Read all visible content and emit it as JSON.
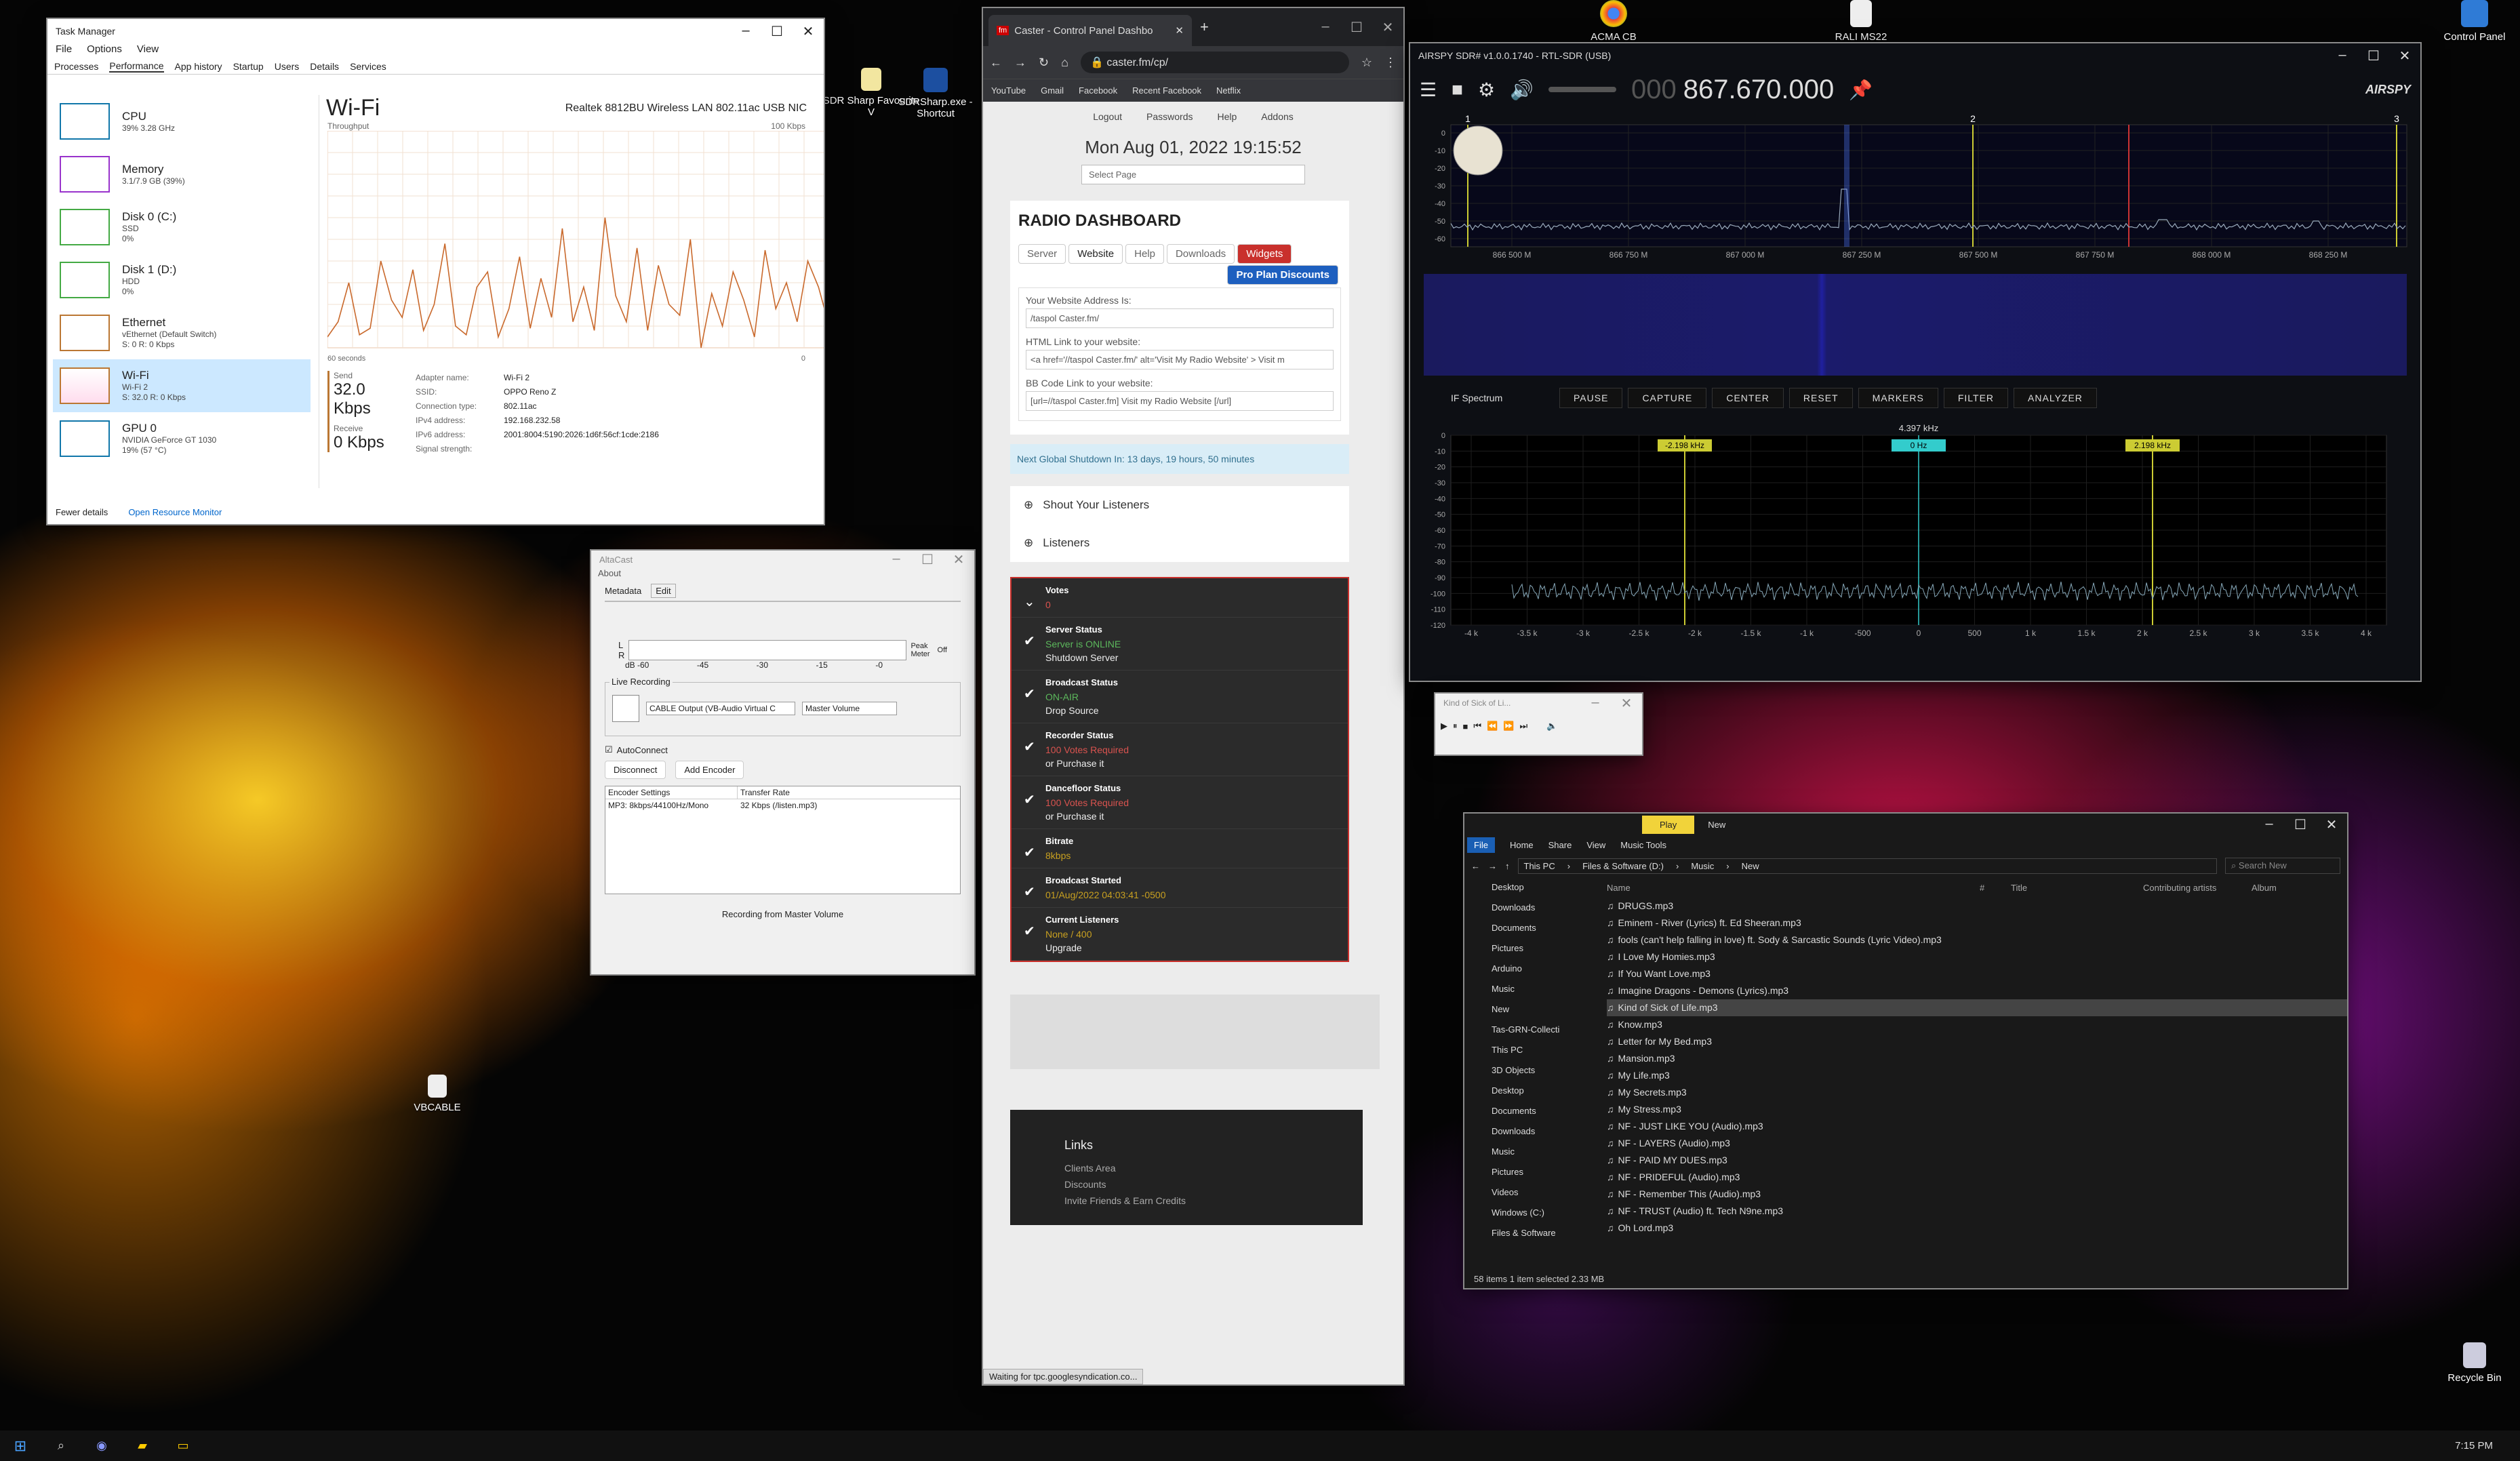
{
  "desktop": {
    "icons": [
      {
        "label": "ACMA CB"
      },
      {
        "label": "RALI MS22"
      },
      {
        "label": "Control Panel"
      },
      {
        "label": "SDR Sharp Favourite V"
      },
      {
        "label": "SDRSharp.exe - Shortcut"
      },
      {
        "label": "VBCABLE"
      },
      {
        "label": "Recycle Bin"
      }
    ]
  },
  "taskmgr": {
    "title": "Task Manager",
    "menu": [
      "File",
      "Options",
      "View"
    ],
    "tabs": [
      "Processes",
      "Performance",
      "App history",
      "Startup",
      "Users",
      "Details",
      "Services"
    ],
    "side": [
      {
        "name": "CPU",
        "l1": "39% 3.28 GHz",
        "l2": ""
      },
      {
        "name": "Memory",
        "l1": "3.1/7.9 GB (39%)",
        "l2": ""
      },
      {
        "name": "Disk 0 (C:)",
        "l1": "SSD",
        "l2": "0%"
      },
      {
        "name": "Disk 1 (D:)",
        "l1": "HDD",
        "l2": "0%"
      },
      {
        "name": "Ethernet",
        "l1": "vEthernet (Default Switch)",
        "l2": "S: 0 R: 0 Kbps"
      },
      {
        "name": "Wi-Fi",
        "l1": "Wi-Fi 2",
        "l2": "S: 32.0 R: 0 Kbps"
      },
      {
        "name": "GPU 0",
        "l1": "NVIDIA GeForce GT 1030",
        "l2": "19% (57 °C)"
      }
    ],
    "main": {
      "heading": "Wi-Fi",
      "adapter": "Realtek 8812BU Wireless LAN 802.11ac USB NIC",
      "chart_label": "Throughput",
      "chart_max": "100 Kbps",
      "chart_time": "60 seconds",
      "chart_zero": "0",
      "send_label": "Send",
      "send_value": "32.0 Kbps",
      "recv_label": "Receive",
      "recv_value": "0 Kbps",
      "details": [
        {
          "k": "Adapter name:",
          "v": "Wi-Fi 2"
        },
        {
          "k": "SSID:",
          "v": "OPPO Reno Z"
        },
        {
          "k": "Connection type:",
          "v": "802.11ac"
        },
        {
          "k": "IPv4 address:",
          "v": "192.168.232.58"
        },
        {
          "k": "IPv6 address:",
          "v": "2001:8004:5190:2026:1d6f:56cf:1cde:2186"
        },
        {
          "k": "Signal strength:",
          "v": ""
        }
      ]
    },
    "fewer": "Fewer details",
    "resmon": "Open Resource Monitor"
  },
  "caster": {
    "tab_title": "Caster - Control Panel Dashbo",
    "url": "caster.fm/cp/",
    "bookmarks": [
      "YouTube",
      "Gmail",
      "Facebook",
      "Recent Facebook",
      "Netflix"
    ],
    "topnav": [
      "Logout",
      "Passwords",
      "Help",
      "Addons"
    ],
    "datetime": "Mon Aug 01, 2022 19:15:52",
    "select_page": "Select Page",
    "dash_title": "RADIO DASHBOARD",
    "dtabs": [
      "Server",
      "Website",
      "Help",
      "Downloads",
      "Widgets"
    ],
    "pro": "Pro Plan Discounts",
    "fields": [
      {
        "label": "Your Website Address Is:",
        "value": "/taspol Caster.fm/"
      },
      {
        "label": "HTML Link to your website:",
        "value": "<a href='//taspol Caster.fm/' alt='Visit My Radio Website' > Visit m"
      },
      {
        "label": "BB Code Link to your website:",
        "value": "[url=//taspol Caster.fm] Visit my Radio Website [/url]"
      }
    ],
    "shutdown": "Next Global Shutdown In: 13 days, 19 hours, 50 minutes",
    "shout": "Shout Your Listeners",
    "listeners": "Listeners",
    "votes_h": "Votes",
    "votes_v": "0",
    "stats": [
      {
        "h": "Server Status",
        "v": "Server is ONLINE",
        "extra": "Shutdown Server",
        "color": "#5cb85c"
      },
      {
        "h": "Broadcast Status",
        "v": "ON-AIR",
        "extra": "Drop Source",
        "color": "#5cb85c"
      },
      {
        "h": "Recorder Status",
        "v": "100 Votes Required",
        "extra": "or Purchase it",
        "color": "#d9534f"
      },
      {
        "h": "Dancefloor Status",
        "v": "100 Votes Required",
        "extra": "or Purchase it",
        "color": "#d9534f"
      },
      {
        "h": "Bitrate",
        "v": "8kbps",
        "extra": "",
        "color": "#c8a020"
      },
      {
        "h": "Broadcast Started",
        "v": "01/Aug/2022 04:03:41 -0500",
        "extra": "",
        "color": "#c8a020"
      },
      {
        "h": "Current Listeners",
        "v": "None / 400",
        "extra": "Upgrade",
        "color": "#c8a020"
      }
    ],
    "links_h": "Links",
    "links": [
      "Clients Area",
      "Discounts",
      "Invite Friends & Earn Credits"
    ],
    "status": "Waiting for tpc.googlesyndication.co..."
  },
  "sdr": {
    "title": "AIRSPY SDR# v1.0.0.1740 - RTL-SDR (USB)",
    "freq_dim": "000",
    "freq": "867.670.000",
    "logo": "AIRSPY",
    "marks": [
      "1",
      "2",
      "3"
    ],
    "db": [
      "0",
      "-10",
      "-20",
      "-30",
      "-40",
      "-50",
      "-60"
    ],
    "fx": [
      "866 500 M",
      "866 750 M",
      "867 000 M",
      "867 250 M",
      "867 500 M",
      "867 750 M",
      "868 000 M",
      "868 250 M"
    ],
    "if_label": "IF Spectrum",
    "buttons": [
      "PAUSE",
      "CAPTURE",
      "CENTER",
      "RESET",
      "MARKERS",
      "FILTER",
      "ANALYZER"
    ],
    "if_bw": "4.397 kHz",
    "if_l": "-2.198 kHz",
    "if_c": "0 Hz",
    "if_r": "2.198 kHz",
    "ify": [
      "0",
      "-10",
      "-20",
      "-30",
      "-40",
      "-50",
      "-60",
      "-70",
      "-80",
      "-90",
      "-100",
      "-110",
      "-120"
    ],
    "ifx": [
      "-4 k",
      "-3.5 k",
      "-3 k",
      "-2.5 k",
      "-2 k",
      "-1.5 k",
      "-1 k",
      "-500",
      "0",
      "500",
      "1 k",
      "1.5 k",
      "2 k",
      "2.5 k",
      "3 k",
      "3.5 k",
      "4 k"
    ]
  },
  "player": {
    "title": "Kind of Sick of Li..."
  },
  "explorer": {
    "ribbon_play": "Play",
    "ribbon_new": "New",
    "tabs": [
      "File",
      "Home",
      "Share",
      "View",
      "Music Tools"
    ],
    "crumbs": [
      "This PC",
      "Files & Software (D:)",
      "Music",
      "New"
    ],
    "search": "Search New",
    "cols": [
      "Name",
      "#",
      "Title",
      "Contributing artists",
      "Album"
    ],
    "nav": [
      "Desktop",
      "Downloads",
      "Documents",
      "Pictures",
      "Arduino",
      "Music",
      "New",
      "Tas-GRN-Collecti",
      "This PC",
      "3D Objects",
      "Desktop",
      "Documents",
      "Downloads",
      "Music",
      "Pictures",
      "Videos",
      "Windows (C:)",
      "Files & Software"
    ],
    "files": [
      "DRUGS.mp3",
      "Eminem - River (Lyrics) ft. Ed Sheeran.mp3",
      "fools (can't help falling in love) ft. Sody & Sarcastic Sounds (Lyric Video).mp3",
      "I Love My Homies.mp3",
      "If You Want Love.mp3",
      "Imagine Dragons - Demons (Lyrics).mp3",
      "Kind of Sick of Life.mp3",
      "Know.mp3",
      "Letter for My Bed.mp3",
      "Mansion.mp3",
      "My Life.mp3",
      "My Secrets.mp3",
      "My Stress.mp3",
      "NF - JUST LIKE YOU (Audio).mp3",
      "NF - LAYERS (Audio).mp3",
      "NF - PAID MY DUES.mp3",
      "NF - PRIDEFUL (Audio).mp3",
      "NF - Remember This (Audio).mp3",
      "NF - TRUST (Audio) ft. Tech N9ne.mp3",
      "Oh Lord.mp3"
    ],
    "selected": "Kind of Sick of Life.mp3",
    "status": "58 items    1 item selected  2.33 MB"
  },
  "altacast": {
    "title": "AltaCast",
    "menu": "About",
    "tabs": [
      "Metadata",
      "Edit"
    ],
    "meter_l": "L",
    "meter_r": "R",
    "peak": "Peak Meter",
    "off": "Off",
    "scale": [
      "dB -60",
      "-45",
      "-30",
      "-15",
      "-0"
    ],
    "live": "Live Recording",
    "device": "CABLE Output (VB-Audio Virtual C",
    "volume": "Master Volume",
    "autoconnect": "AutoConnect",
    "disconnect": "Disconnect",
    "add": "Add Encoder",
    "cols": [
      "Encoder Settings",
      "Transfer Rate"
    ],
    "row": [
      "MP3: 8kbps/44100Hz/Mono",
      "32 Kbps (/listen.mp3)"
    ],
    "footer": "Recording from Master Volume"
  },
  "taskbar": {
    "time": "7:15 PM"
  },
  "chart_data": {
    "type": "line",
    "series": [
      {
        "values": [
          5,
          12,
          30,
          6,
          9,
          40,
          22,
          14,
          36,
          8,
          20,
          48,
          10,
          6,
          28,
          35,
          5,
          18,
          42,
          9,
          32,
          14,
          55,
          12,
          28,
          8,
          60,
          24,
          12,
          46,
          8,
          38,
          20,
          15,
          50,
          0,
          25,
          10,
          35,
          22,
          5,
          45,
          18,
          30,
          12,
          40,
          28,
          10
        ]
      }
    ],
    "ylim": [
      0,
      100
    ]
  }
}
